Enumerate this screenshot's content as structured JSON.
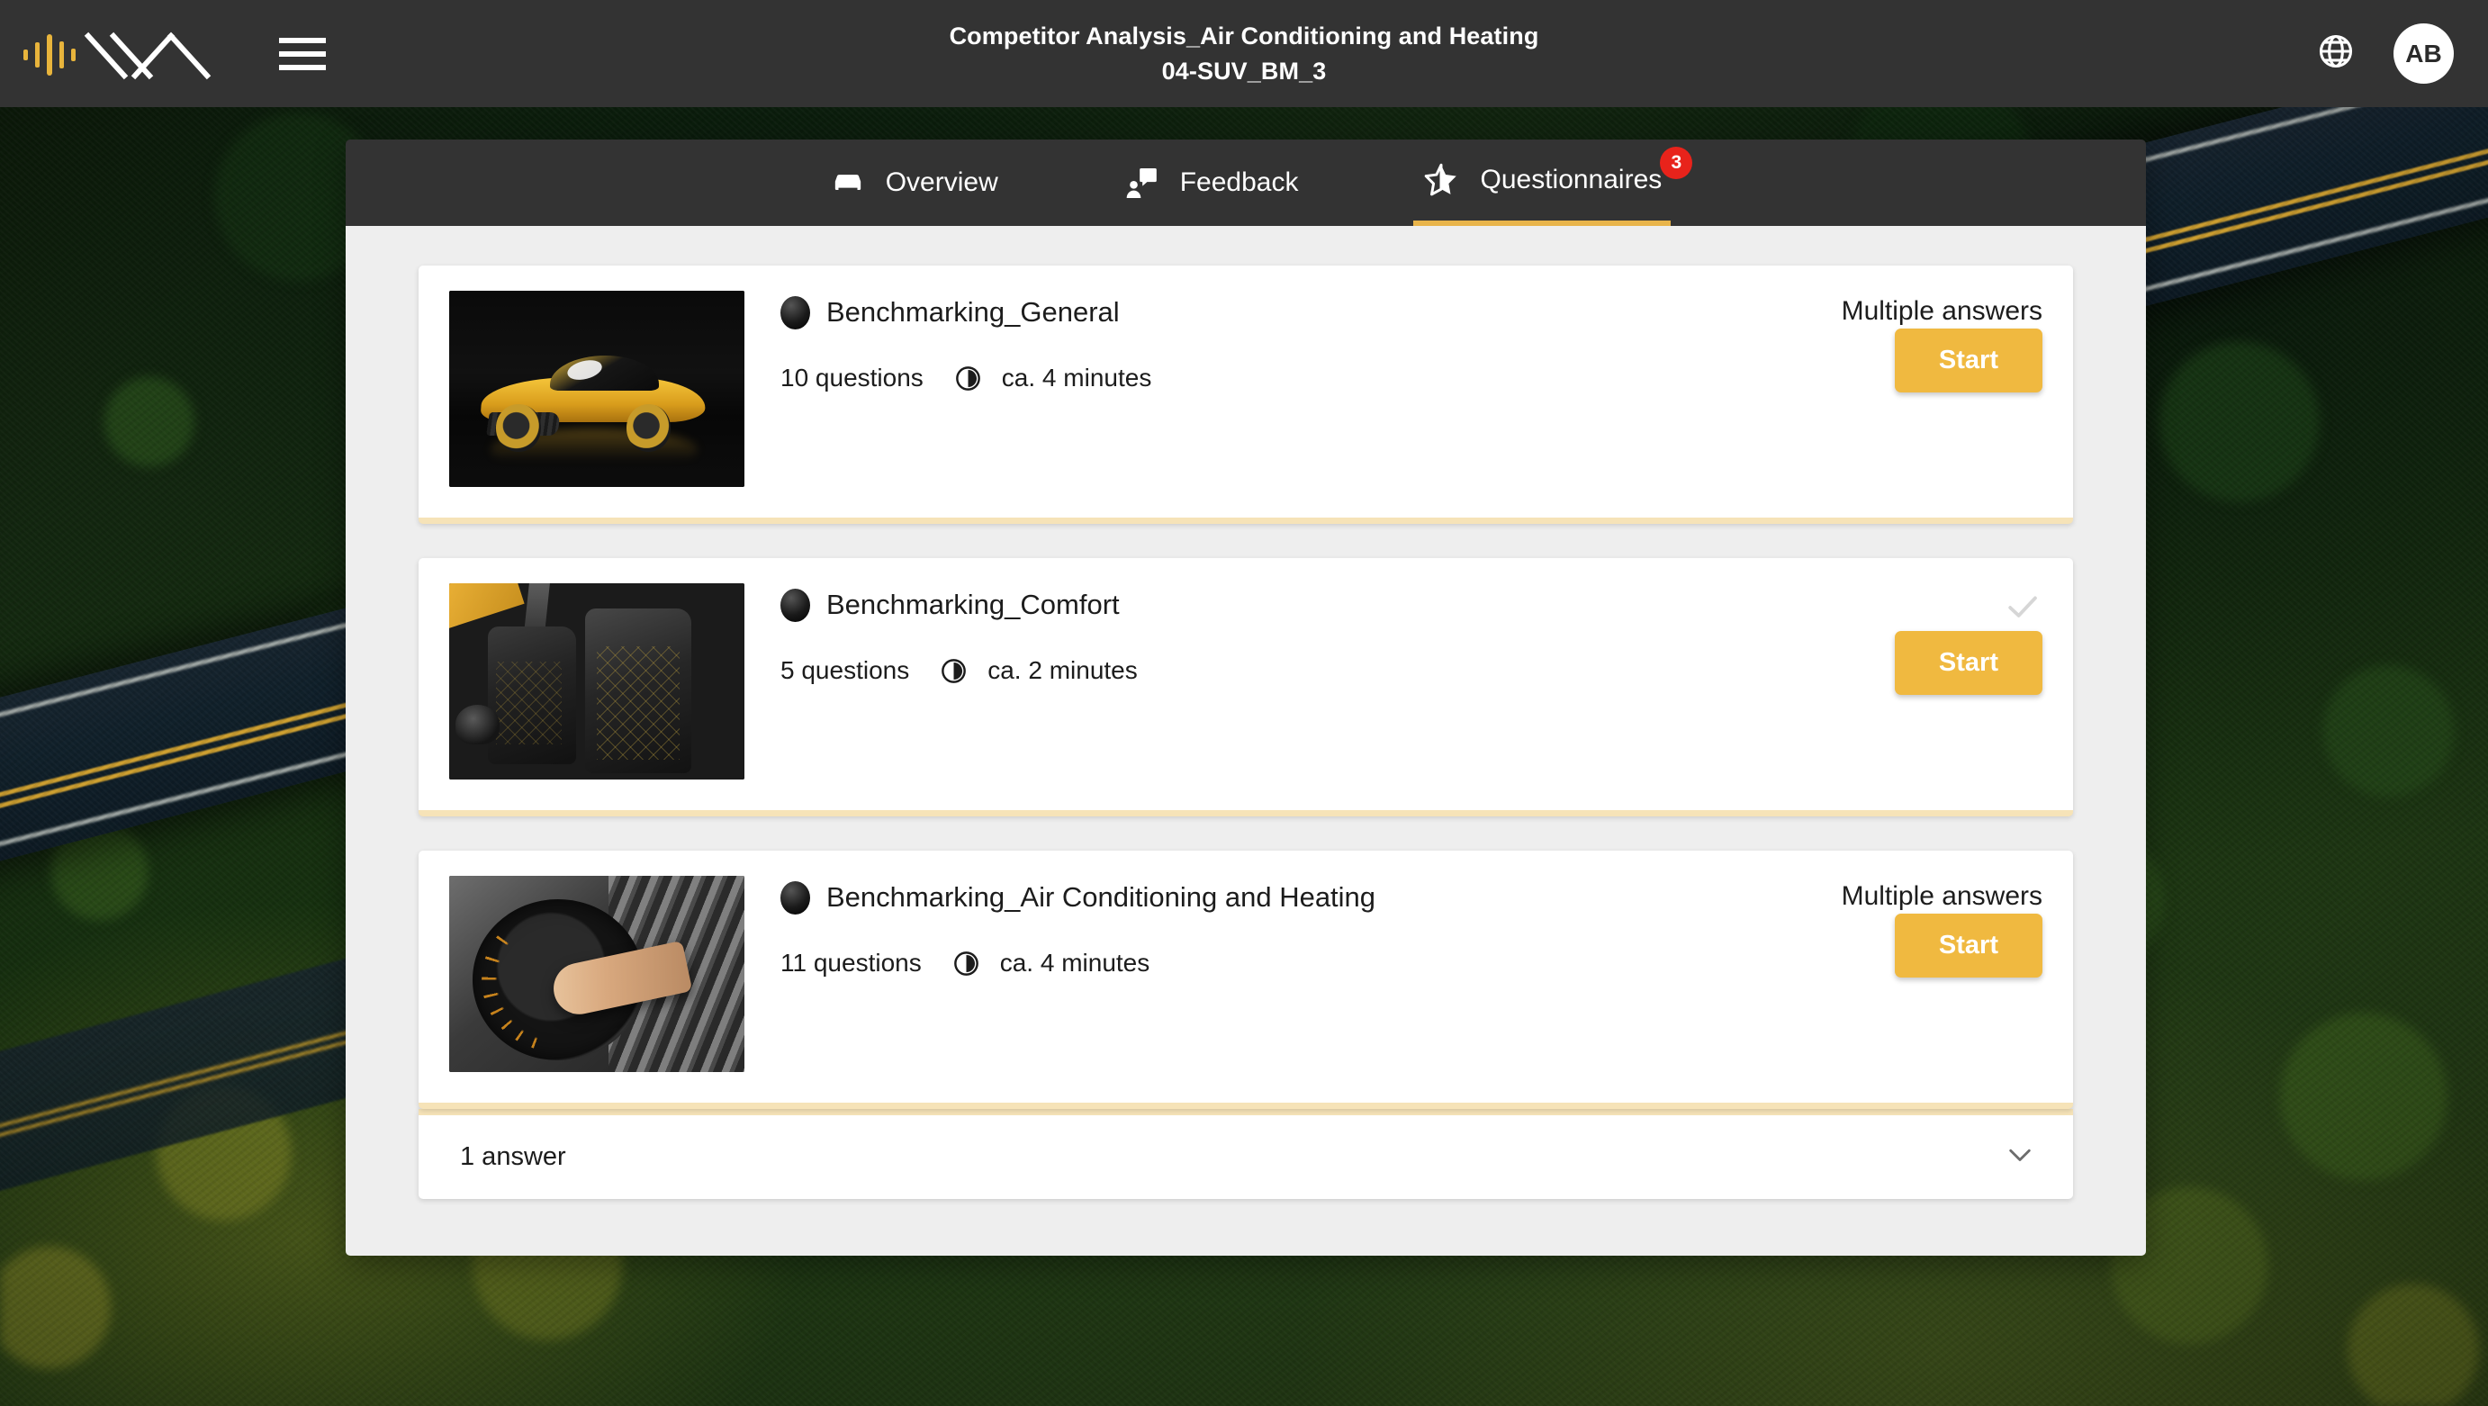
{
  "header": {
    "title_line1": "Competitor Analysis_Air Conditioning and Heating",
    "title_line2": "04-SUV_BM_3",
    "logo_name": "waveform-chevron-logo",
    "menu_icon": "hamburger-menu-icon",
    "language_icon": "globe-icon",
    "avatar_initials": "AB"
  },
  "tabs": [
    {
      "label": "Overview",
      "icon": "car-icon",
      "active": false,
      "badge": null
    },
    {
      "label": "Feedback",
      "icon": "feedback-icon",
      "active": false,
      "badge": null
    },
    {
      "label": "Questionnaires",
      "icon": "star-icon",
      "active": true,
      "badge": "3"
    }
  ],
  "questionnaires": [
    {
      "title": "Benchmarking_General",
      "questions": "10 questions",
      "duration": "ca. 4 minutes",
      "answers_label": "Multiple answers",
      "start_label": "Start",
      "completed": false,
      "thumb": "sports-car-thumbnail"
    },
    {
      "title": "Benchmarking_Comfort",
      "questions": "5 questions",
      "duration": "ca. 2 minutes",
      "answers_label": "",
      "start_label": "Start",
      "completed": true,
      "thumb": "car-seats-thumbnail"
    },
    {
      "title": "Benchmarking_Air Conditioning and Heating",
      "questions": "11 questions",
      "duration": "ca. 4 minutes",
      "answers_label": "Multiple answers",
      "start_label": "Start",
      "completed": false,
      "thumb": "climate-dial-thumbnail"
    }
  ],
  "answers_bar": {
    "label": "1 answer",
    "chevron_icon": "chevron-down-icon"
  },
  "colors": {
    "header_bg": "#333333",
    "content_bg": "#eeeeee",
    "accent_gold": "#f0b940",
    "accent_underline": "#e8b44a",
    "card_bottom_strip": "#f6e3b8",
    "badge_red": "#e8231b",
    "card_bg": "#ffffff",
    "text_dark": "#1c1c1c",
    "check_gray": "#d6d6d6"
  }
}
